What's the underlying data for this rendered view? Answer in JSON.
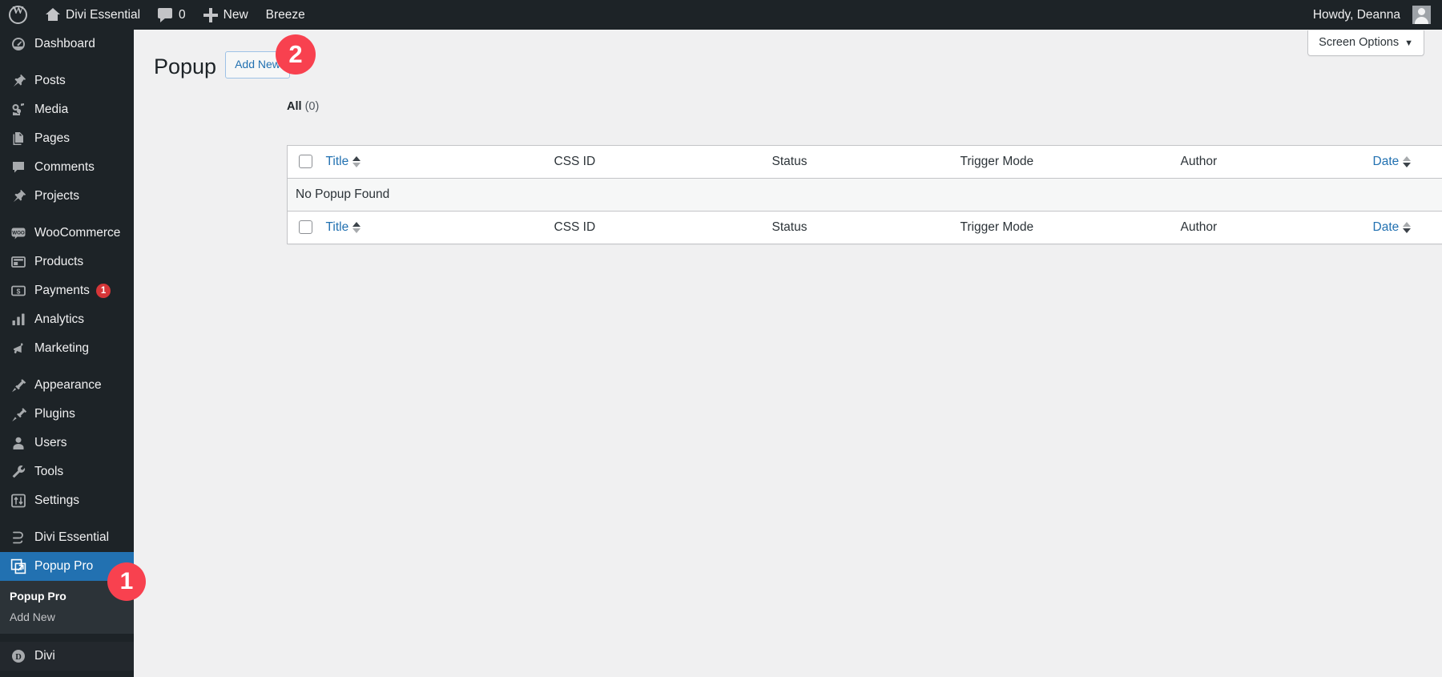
{
  "admin_bar": {
    "wp_logo": "wordpress-logo",
    "site_name": "Divi Essential",
    "comments_count": "0",
    "new_label": "New",
    "breeze_label": "Breeze",
    "howdy": "Howdy, Deanna"
  },
  "sidebar": {
    "items": [
      {
        "label": "Dashboard",
        "icon": "dashboard-icon",
        "active": false,
        "group": 0
      },
      {
        "label": "Posts",
        "icon": "pin-icon",
        "active": false,
        "group": 1
      },
      {
        "label": "Media",
        "icon": "media-icon",
        "active": false,
        "group": 1
      },
      {
        "label": "Pages",
        "icon": "pages-icon",
        "active": false,
        "group": 1
      },
      {
        "label": "Comments",
        "icon": "comment-icon",
        "active": false,
        "group": 1
      },
      {
        "label": "Projects",
        "icon": "pin-icon",
        "active": false,
        "group": 1
      },
      {
        "label": "WooCommerce",
        "icon": "woocommerce-icon",
        "active": false,
        "group": 2
      },
      {
        "label": "Products",
        "icon": "products-icon",
        "active": false,
        "group": 2
      },
      {
        "label": "Payments",
        "icon": "payments-icon",
        "active": false,
        "group": 2,
        "badge": "1"
      },
      {
        "label": "Analytics",
        "icon": "analytics-icon",
        "active": false,
        "group": 2
      },
      {
        "label": "Marketing",
        "icon": "marketing-icon",
        "active": false,
        "group": 2
      },
      {
        "label": "Appearance",
        "icon": "appearance-icon",
        "active": false,
        "group": 3
      },
      {
        "label": "Plugins",
        "icon": "plugins-icon",
        "active": false,
        "group": 3
      },
      {
        "label": "Users",
        "icon": "users-icon",
        "active": false,
        "group": 3
      },
      {
        "label": "Tools",
        "icon": "tools-icon",
        "active": false,
        "group": 3
      },
      {
        "label": "Settings",
        "icon": "settings-icon",
        "active": false,
        "group": 3
      },
      {
        "label": "Divi Essential",
        "icon": "divi-essential-icon",
        "active": false,
        "group": 4
      },
      {
        "label": "Popup Pro",
        "icon": "popup-pro-icon",
        "active": true,
        "group": 4
      },
      {
        "label": "Divi",
        "icon": "divi-icon",
        "active": false,
        "group": 5
      }
    ],
    "submenu": [
      {
        "label": "Popup Pro",
        "current": true
      },
      {
        "label": "Add New",
        "current": false
      }
    ]
  },
  "screen_options": {
    "label": "Screen Options",
    "caret": "▼"
  },
  "page": {
    "title": "Popup",
    "add_new_label": "Add New"
  },
  "filters": {
    "all_label": "All",
    "all_count": "(0)"
  },
  "table": {
    "columns": [
      {
        "label": "Title",
        "sortable": true
      },
      {
        "label": "CSS ID",
        "sortable": false
      },
      {
        "label": "Status",
        "sortable": false
      },
      {
        "label": "Trigger Mode",
        "sortable": false
      },
      {
        "label": "Author",
        "sortable": false
      },
      {
        "label": "Date",
        "sortable": true
      }
    ],
    "empty_message": "No Popup Found",
    "rows": []
  },
  "step_badges": [
    {
      "number": "1",
      "target": "sidebar-item-popup-pro"
    },
    {
      "number": "2",
      "target": "add-new-button"
    }
  ],
  "colors": {
    "admin_bar_bg": "#1d2327",
    "sidebar_bg": "#1d2327",
    "active_menu": "#2271b1",
    "link_blue": "#2271b1",
    "badge_red": "#f8414f",
    "count_red": "#d63638",
    "content_bg": "#f0f0f1"
  }
}
